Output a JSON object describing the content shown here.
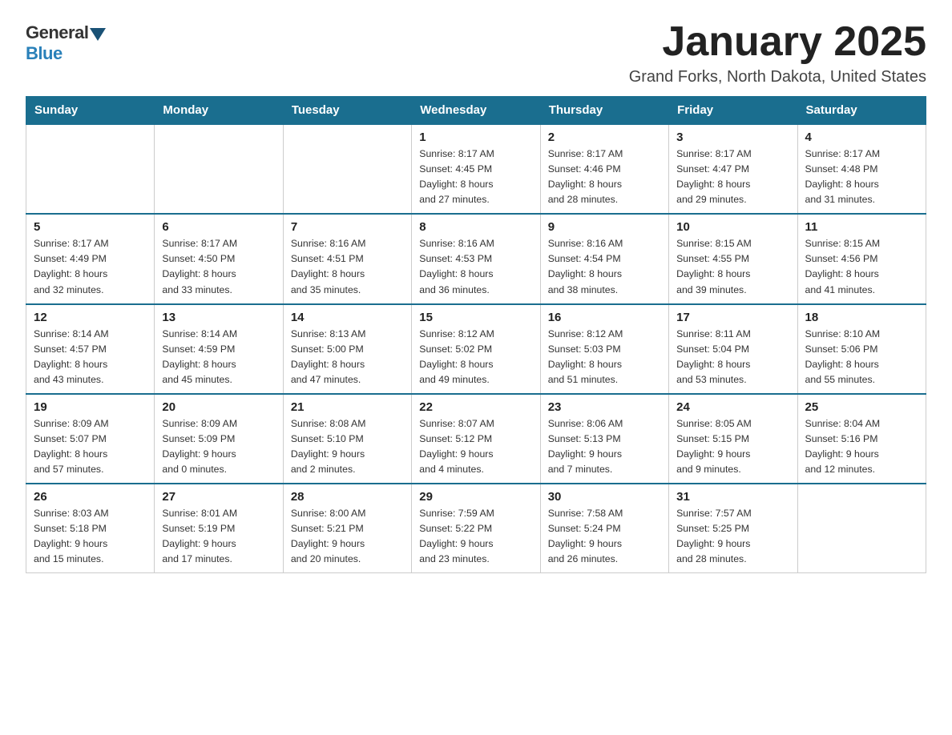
{
  "logo": {
    "general": "General",
    "blue": "Blue"
  },
  "title": "January 2025",
  "location": "Grand Forks, North Dakota, United States",
  "weekdays": [
    "Sunday",
    "Monday",
    "Tuesday",
    "Wednesday",
    "Thursday",
    "Friday",
    "Saturday"
  ],
  "weeks": [
    [
      {
        "day": "",
        "info": ""
      },
      {
        "day": "",
        "info": ""
      },
      {
        "day": "",
        "info": ""
      },
      {
        "day": "1",
        "info": "Sunrise: 8:17 AM\nSunset: 4:45 PM\nDaylight: 8 hours\nand 27 minutes."
      },
      {
        "day": "2",
        "info": "Sunrise: 8:17 AM\nSunset: 4:46 PM\nDaylight: 8 hours\nand 28 minutes."
      },
      {
        "day": "3",
        "info": "Sunrise: 8:17 AM\nSunset: 4:47 PM\nDaylight: 8 hours\nand 29 minutes."
      },
      {
        "day": "4",
        "info": "Sunrise: 8:17 AM\nSunset: 4:48 PM\nDaylight: 8 hours\nand 31 minutes."
      }
    ],
    [
      {
        "day": "5",
        "info": "Sunrise: 8:17 AM\nSunset: 4:49 PM\nDaylight: 8 hours\nand 32 minutes."
      },
      {
        "day": "6",
        "info": "Sunrise: 8:17 AM\nSunset: 4:50 PM\nDaylight: 8 hours\nand 33 minutes."
      },
      {
        "day": "7",
        "info": "Sunrise: 8:16 AM\nSunset: 4:51 PM\nDaylight: 8 hours\nand 35 minutes."
      },
      {
        "day": "8",
        "info": "Sunrise: 8:16 AM\nSunset: 4:53 PM\nDaylight: 8 hours\nand 36 minutes."
      },
      {
        "day": "9",
        "info": "Sunrise: 8:16 AM\nSunset: 4:54 PM\nDaylight: 8 hours\nand 38 minutes."
      },
      {
        "day": "10",
        "info": "Sunrise: 8:15 AM\nSunset: 4:55 PM\nDaylight: 8 hours\nand 39 minutes."
      },
      {
        "day": "11",
        "info": "Sunrise: 8:15 AM\nSunset: 4:56 PM\nDaylight: 8 hours\nand 41 minutes."
      }
    ],
    [
      {
        "day": "12",
        "info": "Sunrise: 8:14 AM\nSunset: 4:57 PM\nDaylight: 8 hours\nand 43 minutes."
      },
      {
        "day": "13",
        "info": "Sunrise: 8:14 AM\nSunset: 4:59 PM\nDaylight: 8 hours\nand 45 minutes."
      },
      {
        "day": "14",
        "info": "Sunrise: 8:13 AM\nSunset: 5:00 PM\nDaylight: 8 hours\nand 47 minutes."
      },
      {
        "day": "15",
        "info": "Sunrise: 8:12 AM\nSunset: 5:02 PM\nDaylight: 8 hours\nand 49 minutes."
      },
      {
        "day": "16",
        "info": "Sunrise: 8:12 AM\nSunset: 5:03 PM\nDaylight: 8 hours\nand 51 minutes."
      },
      {
        "day": "17",
        "info": "Sunrise: 8:11 AM\nSunset: 5:04 PM\nDaylight: 8 hours\nand 53 minutes."
      },
      {
        "day": "18",
        "info": "Sunrise: 8:10 AM\nSunset: 5:06 PM\nDaylight: 8 hours\nand 55 minutes."
      }
    ],
    [
      {
        "day": "19",
        "info": "Sunrise: 8:09 AM\nSunset: 5:07 PM\nDaylight: 8 hours\nand 57 minutes."
      },
      {
        "day": "20",
        "info": "Sunrise: 8:09 AM\nSunset: 5:09 PM\nDaylight: 9 hours\nand 0 minutes."
      },
      {
        "day": "21",
        "info": "Sunrise: 8:08 AM\nSunset: 5:10 PM\nDaylight: 9 hours\nand 2 minutes."
      },
      {
        "day": "22",
        "info": "Sunrise: 8:07 AM\nSunset: 5:12 PM\nDaylight: 9 hours\nand 4 minutes."
      },
      {
        "day": "23",
        "info": "Sunrise: 8:06 AM\nSunset: 5:13 PM\nDaylight: 9 hours\nand 7 minutes."
      },
      {
        "day": "24",
        "info": "Sunrise: 8:05 AM\nSunset: 5:15 PM\nDaylight: 9 hours\nand 9 minutes."
      },
      {
        "day": "25",
        "info": "Sunrise: 8:04 AM\nSunset: 5:16 PM\nDaylight: 9 hours\nand 12 minutes."
      }
    ],
    [
      {
        "day": "26",
        "info": "Sunrise: 8:03 AM\nSunset: 5:18 PM\nDaylight: 9 hours\nand 15 minutes."
      },
      {
        "day": "27",
        "info": "Sunrise: 8:01 AM\nSunset: 5:19 PM\nDaylight: 9 hours\nand 17 minutes."
      },
      {
        "day": "28",
        "info": "Sunrise: 8:00 AM\nSunset: 5:21 PM\nDaylight: 9 hours\nand 20 minutes."
      },
      {
        "day": "29",
        "info": "Sunrise: 7:59 AM\nSunset: 5:22 PM\nDaylight: 9 hours\nand 23 minutes."
      },
      {
        "day": "30",
        "info": "Sunrise: 7:58 AM\nSunset: 5:24 PM\nDaylight: 9 hours\nand 26 minutes."
      },
      {
        "day": "31",
        "info": "Sunrise: 7:57 AM\nSunset: 5:25 PM\nDaylight: 9 hours\nand 28 minutes."
      },
      {
        "day": "",
        "info": ""
      }
    ]
  ]
}
